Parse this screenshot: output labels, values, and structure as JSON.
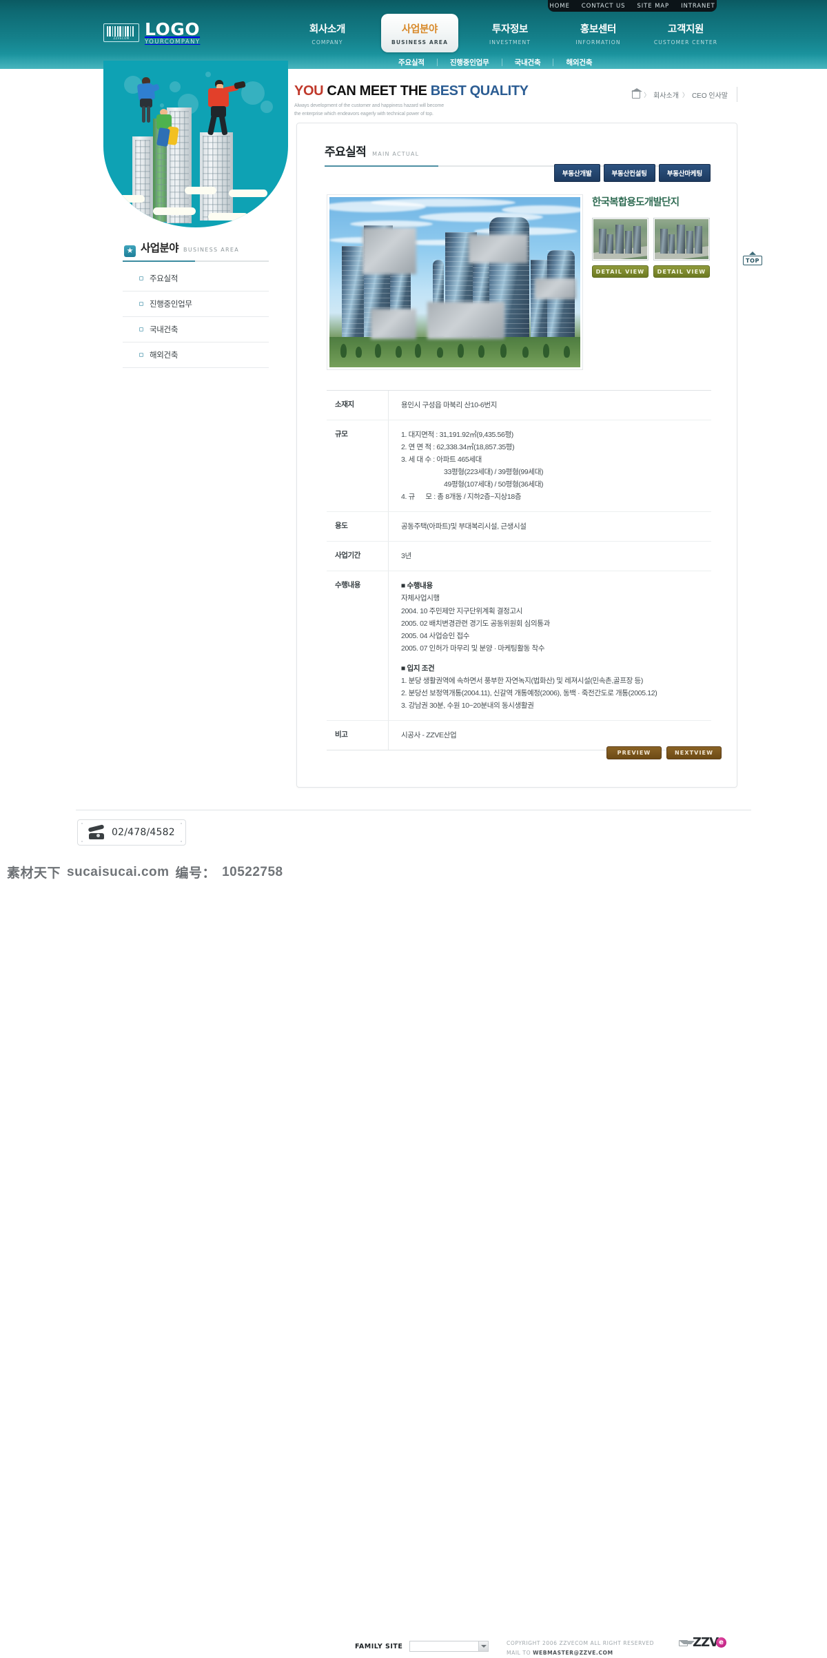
{
  "utility": {
    "items": [
      {
        "label": "HOME",
        "name": "home"
      },
      {
        "label": "CONTACT US",
        "name": "contact-us"
      },
      {
        "label": "SITE MAP",
        "name": "site-map"
      },
      {
        "label": "INTRANET",
        "name": "intranet"
      }
    ]
  },
  "logo": {
    "title": "LOGO",
    "subtitle": "YOURCOMPANY",
    "barcode_label": "ZZVECOM"
  },
  "mainnav": {
    "items": [
      {
        "kr": "회사소개",
        "en": "COMPANY",
        "active": false
      },
      {
        "kr": "사업분야",
        "en": "BUSINESS AREA",
        "active": true
      },
      {
        "kr": "투자정보",
        "en": "INVESTMENT",
        "active": false
      },
      {
        "kr": "홍보센터",
        "en": "INFORMATION",
        "active": false
      },
      {
        "kr": "고객지원",
        "en": "CUSTOMER CENTER",
        "active": false
      }
    ]
  },
  "subnav": {
    "items": [
      "주요실적",
      "진행중인업무",
      "국내건축",
      "해외건축"
    ]
  },
  "tagline": {
    "line1_you": "YOU",
    "line1_mid": "CAN MEET THE",
    "line1_best": "BEST",
    "line1_quality": "QUALITY",
    "desc1": "Always development of the customer and happiness hazard will become",
    "desc2": "the enterprise which endeavors eagerly with technical power of top."
  },
  "breadcrumb": {
    "home_icon": "home-icon",
    "items": [
      "회사소개",
      "CEO 인사말"
    ],
    "separator": "〉"
  },
  "sidebar": {
    "title_kr": "사업분야",
    "title_en": "BUSINESS AREA",
    "star_icon": "★",
    "items": [
      {
        "label": "주요실적",
        "active": true
      },
      {
        "label": "진행중인업무",
        "active": false
      },
      {
        "label": "국내건축",
        "active": false
      },
      {
        "label": "해외건축",
        "active": false
      }
    ]
  },
  "panel": {
    "title_kr": "주요실적",
    "title_en": "MAIN ACTUAL",
    "tabs": [
      "부동산개발",
      "부동산컨설팅",
      "부동산마케팅"
    ]
  },
  "project": {
    "name": "한국복합용도개발단지",
    "thumbnails": [
      {
        "detail_label": "DETAIL VIEW"
      },
      {
        "detail_label": "DETAIL VIEW"
      }
    ]
  },
  "table": {
    "rows": [
      {
        "label": "소재지",
        "lines": [
          {
            "text": "용인시 구성읍 마북리 산10-6번지",
            "style": "normal"
          }
        ]
      },
      {
        "label": "규모",
        "lines": [
          {
            "text": "1. 대지면적 : 31,191.92㎡(9,435.56평)",
            "style": "normal"
          },
          {
            "text": "2. 연 면 적 : 62,338.34㎡(18,857.35평)",
            "style": "normal"
          },
          {
            "text": "3. 세 대 수 : 아파트 465세대",
            "style": "normal"
          },
          {
            "text": "33평형(223세대) / 39평형(99세대)",
            "style": "indent"
          },
          {
            "text": "49평형(107세대) / 50평형(36세대)",
            "style": "indent"
          },
          {
            "text": "4. 규      모 : 총 8개동 / 지하2층~지상18층",
            "style": "normal"
          }
        ]
      },
      {
        "label": "용도",
        "lines": [
          {
            "text": "공동주택(아파트)및 부대복리시설, 근생시설",
            "style": "normal"
          }
        ]
      },
      {
        "label": "사업기간",
        "lines": [
          {
            "text": "3년",
            "style": "normal"
          }
        ]
      },
      {
        "label": "수행내용",
        "lines": [
          {
            "text": "■ 수행내용",
            "style": "bold"
          },
          {
            "text": "자체사업시행",
            "style": "normal"
          },
          {
            "text": "2004. 10 주민제안 지구단위계획 결정고시",
            "style": "normal"
          },
          {
            "text": "2005. 02 배치변경관련 경기도 공동위원회 심의통과",
            "style": "normal"
          },
          {
            "text": "2005. 04 사업승인 접수",
            "style": "normal"
          },
          {
            "text": "2005. 07 인허가 마무리 및 분양 · 마케팅활동 착수",
            "style": "normal"
          },
          {
            "text": "",
            "style": "gap"
          },
          {
            "text": "■ 입지 조건",
            "style": "bold"
          },
          {
            "text": "1. 분당 생활권역에 속하면서 풍부한 자연녹지(법화산) 및 레져시설(민속촌,골프장 등)",
            "style": "normal"
          },
          {
            "text": "2. 분당선 보정역개통(2004.11), 신갈역 개통예정(2006), 동백 · 죽전간도로 개통(2005.12)",
            "style": "normal"
          },
          {
            "text": "3. 강남권 30분, 수원 10~20분내의 동시생활권",
            "style": "normal"
          }
        ]
      },
      {
        "label": "비고",
        "lines": [
          {
            "text": "시공사 - ZZVE산업",
            "style": "normal"
          }
        ]
      }
    ]
  },
  "pager": {
    "prev": "PREVIEW",
    "next": "NEXTVIEW"
  },
  "top_button": {
    "label": "TOP"
  },
  "footer": {
    "tel": "02/478/4582",
    "family_site_label": "FAMILY SITE",
    "family_site_value": "",
    "copyright_line1": "COPYRIGHT  2006  ZZVECOM ALL RIGHT RESERVED",
    "copyright_line2_pre": "MAIL TO ",
    "copyright_line2_mail": "WEBMASTER@ZZVE.COM",
    "brand_zz": "ZZV",
    "brand_e": "e"
  },
  "watermark": {
    "cn": "素材天下",
    "site": "sucaisucai.com",
    "id_label": "编号：",
    "id": "10522758"
  },
  "colors": {
    "header_teal": "#14808a",
    "accent_orange": "#d8892a",
    "tab_blue": "#1d3b60",
    "detail_olive": "#6d7a22",
    "pager_brown": "#6d4a15",
    "project_green": "#2f6b53"
  }
}
